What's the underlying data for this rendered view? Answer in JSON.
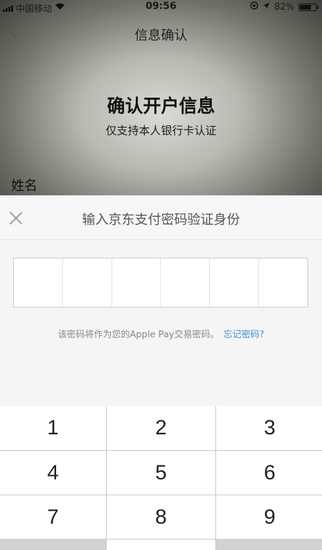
{
  "status_bar": {
    "carrier": "中国移动",
    "time": "09:56",
    "battery": "82%",
    "battery_level": 0.82
  },
  "nav": {
    "title": "信息确认",
    "back_icon": "chevron-left-icon"
  },
  "page": {
    "heading": "确认开户信息",
    "subheading": "仅支持本人银行卡认证",
    "name_label": "姓名"
  },
  "sheet": {
    "title": "输入京东支付密码验证身份",
    "close_icon": "close-icon",
    "pin_length": 6,
    "hint": "该密码将作为您的Apple Pay交易密码。",
    "forgot": "忘记密码?"
  },
  "keypad": {
    "keys": [
      "1",
      "2",
      "3",
      "4",
      "5",
      "6",
      "7",
      "8",
      "9"
    ]
  }
}
